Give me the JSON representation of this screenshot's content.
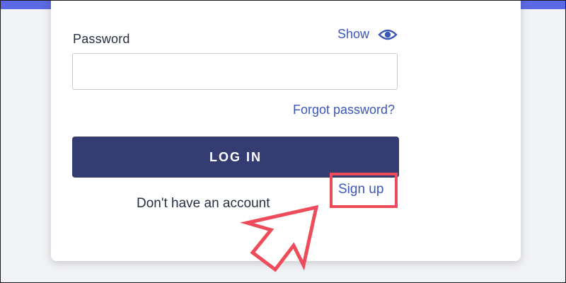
{
  "form": {
    "password_label": "Password",
    "show_label": "Show",
    "password_value": "",
    "password_placeholder": "",
    "forgot_password_label": "Forgot password?",
    "login_button_label": "LOG IN",
    "signup_prompt": "Don't have an account",
    "signup_link_label": "Sign up"
  },
  "icons": {
    "show": "eye-icon",
    "annotation": "arrow-icon"
  },
  "colors": {
    "top_band": "#5b69e2",
    "link": "#3b58b8",
    "button": "#343c72",
    "annotation": "#ee4c5a",
    "text": "#263042"
  }
}
